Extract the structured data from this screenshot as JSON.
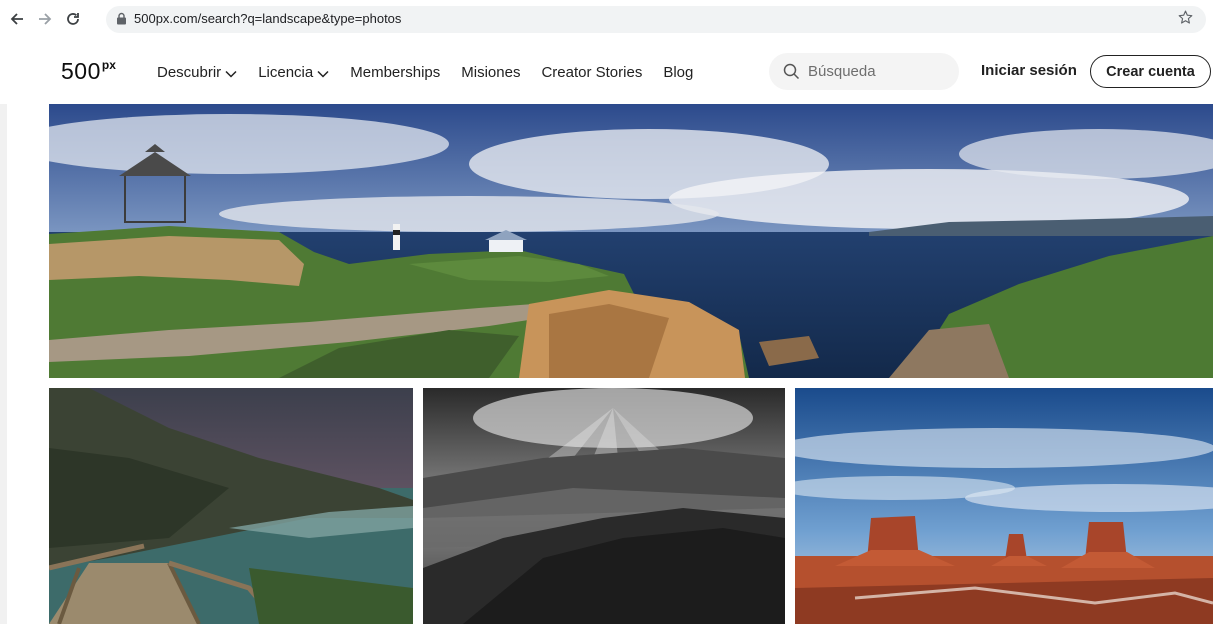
{
  "browser": {
    "url": "500px.com/search?q=landscape&type=photos"
  },
  "header": {
    "logo_text": "500",
    "logo_sup": "px",
    "nav": [
      {
        "label": "Descubrir",
        "has_dropdown": true
      },
      {
        "label": "Licencia",
        "has_dropdown": true
      },
      {
        "label": "Memberships",
        "has_dropdown": false
      },
      {
        "label": "Misiones",
        "has_dropdown": false
      },
      {
        "label": "Creator Stories",
        "has_dropdown": false
      },
      {
        "label": "Blog",
        "has_dropdown": false
      }
    ],
    "search_placeholder": "Búsqueda",
    "login_label": "Iniciar sesión",
    "signup_label": "Crear cuenta"
  },
  "photos": [
    {
      "subject": "coastal panorama with lighthouse and gazebo"
    },
    {
      "subject": "cliffside wooden boardwalk by the sea"
    },
    {
      "subject": "black and white sun rays over forest valley"
    },
    {
      "subject": "desert buttes under blue sky"
    }
  ],
  "colors": {
    "text": "#222222",
    "chrome_bg": "#f1f3f4",
    "search_bg": "#f4f4f4"
  }
}
